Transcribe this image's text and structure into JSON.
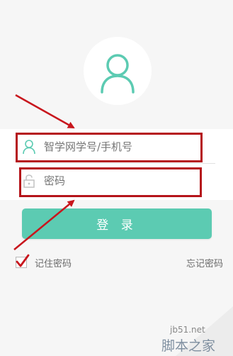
{
  "login": {
    "username_placeholder": "智学网学号/手机号",
    "password_placeholder": "密码",
    "login_button": "登 录",
    "remember_label": "记住密码",
    "remember_checked": true,
    "forgot_label": "忘记密码"
  },
  "watermark": {
    "site": "jb51.net",
    "logo": "脚本之家"
  },
  "colors": {
    "accent": "#5ccbb2",
    "highlight": "#b5141a",
    "placeholder": "#bdbdbd"
  }
}
